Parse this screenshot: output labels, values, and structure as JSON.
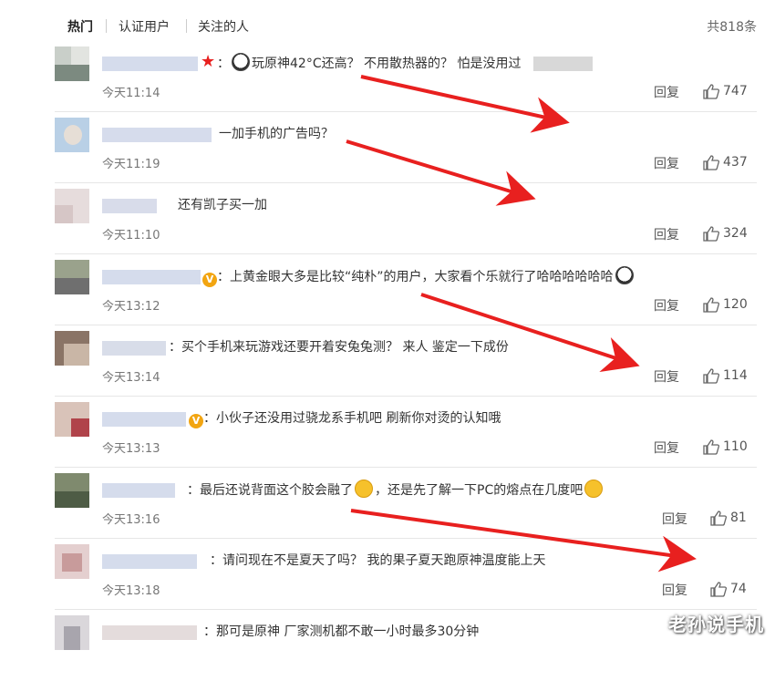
{
  "tabs": [
    {
      "label": "热门"
    },
    {
      "label": "认证用户"
    },
    {
      "label": "关注的人"
    }
  ],
  "total": "共818条",
  "comments": [
    {
      "text": "玩原神42°C还高？ 不用散热器的？ 怕是没用过",
      "time": "今天11:14",
      "reply": "回复",
      "likes": "747"
    },
    {
      "text": "一加手机的广告吗？",
      "time": "今天11:19",
      "reply": "回复",
      "likes": "437"
    },
    {
      "text": "还有凯子买一加",
      "time": "今天11:10",
      "reply": "回复",
      "likes": "324"
    },
    {
      "text": "上黄金眼大多是比较“纯朴”的用户，大家看个乐就行了哈哈哈哈哈哈",
      "time": "今天13:12",
      "reply": "回复",
      "likes": "120"
    },
    {
      "text": "买个手机来玩游戏还要开着安兔兔测？ 来人 鉴定一下成份",
      "time": "今天13:14",
      "reply": "回复",
      "likes": "114"
    },
    {
      "text": "小伙子还没用过骁龙系手机吧 刷新你对烫的认知哦",
      "time": "今天13:13",
      "reply": "回复",
      "likes": "110"
    },
    {
      "text_a": "最后还说背面这个胶会融了",
      "text_b": "，还是先了解一下PC的熔点在几度吧",
      "time": "今天13:16",
      "reply": "回复",
      "likes": "81"
    },
    {
      "text": "请问现在不是夏天了吗？ 我的果子夏天跑原神温度能上天",
      "time": "今天13:18",
      "reply": "回复",
      "likes": "74"
    },
    {
      "text": "那可是原神 厂家测机都不敢一小时最多30分钟"
    }
  ],
  "colon": "：",
  "vbadge": "V",
  "watermark": "老孙说手机",
  "colors": {
    "arrow": "#e8201f",
    "star": "#e8201f",
    "vip": "#f2a511"
  }
}
